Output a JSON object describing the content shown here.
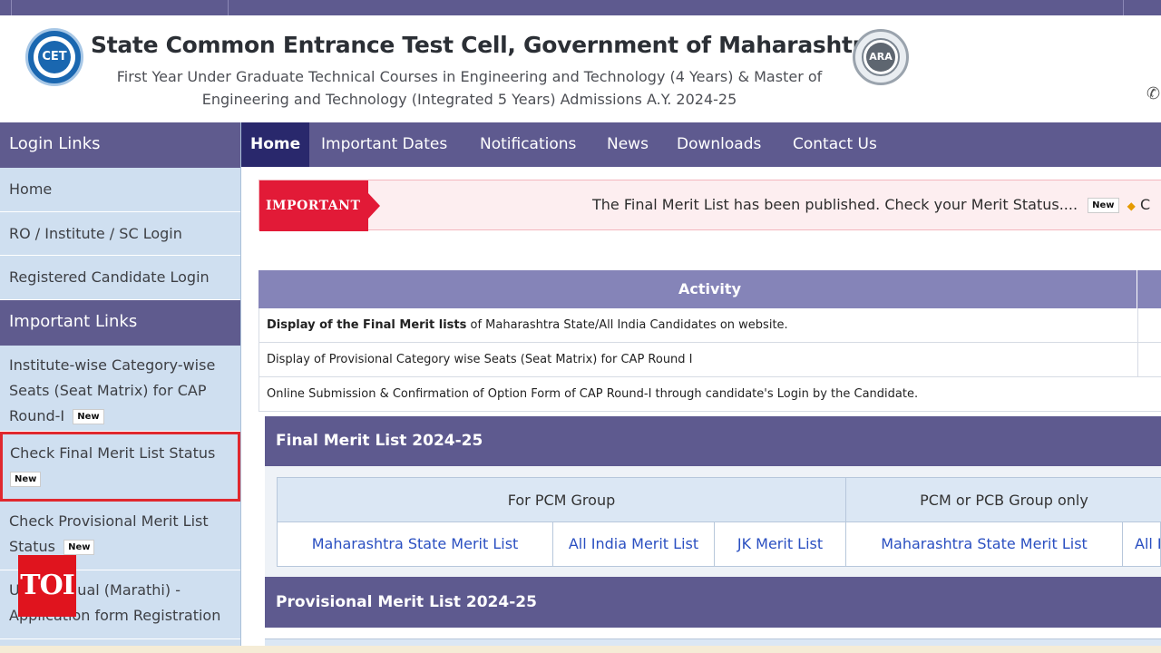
{
  "header": {
    "title": "State Common Entrance Test Cell, Government of Maharashtra",
    "subtitle_line1": "First Year Under Graduate Technical Courses in Engineering and Technology (4 Years) & Master of",
    "subtitle_line2": "Engineering and Technology (Integrated 5 Years) Admissions A.Y. 2024-25",
    "logo_left_text": "CET",
    "logo_right_text": "ARA",
    "phone_icon": "phone-icon"
  },
  "sidebar": {
    "login_heading": "Login Links",
    "login_items": [
      "Home",
      "RO / Institute / SC Login",
      "Registered Candidate Login"
    ],
    "important_heading": "Important Links",
    "important_items": [
      {
        "label": "Institute-wise Category-wise Seats (Seat Matrix) for CAP Round-I",
        "badge": "New"
      },
      {
        "label": "Check Final Merit List Status",
        "badge": "New"
      },
      {
        "label": "Check Provisional Merit List Status",
        "badge": "New"
      },
      {
        "label": "User Manual (Marathi) - Application form Registration",
        "badge": ""
      }
    ]
  },
  "nav": {
    "items": [
      "Home",
      "Important Dates",
      "Notifications",
      "News",
      "Downloads",
      "Contact Us"
    ],
    "active": "Home"
  },
  "important_bar": {
    "label": "IMPORTANT",
    "text": "The Final Merit List has been published. Check your Merit Status....",
    "badge": "New",
    "trailing": "C"
  },
  "activity_table": {
    "header": "Activity",
    "rows": [
      {
        "bold": "Display of the Final Merit lists",
        "rest": " of Maharashtra State/All India Candidates on website."
      },
      {
        "bold": "",
        "rest": "Display of Provisional Category wise Seats (Seat Matrix) for CAP Round I"
      },
      {
        "bold": "",
        "rest": "Online Submission & Confirmation of Option Form of CAP Round-I through candidate's Login by the Candidate."
      }
    ]
  },
  "final_merit": {
    "title": "Final Merit List 2024-25",
    "groups": [
      "For PCM Group",
      "PCM or PCB Group only"
    ],
    "links": [
      "Maharashtra State Merit List",
      "All India Merit List",
      "JK Merit List",
      "Maharashtra State Merit List",
      "All I"
    ]
  },
  "provisional_merit": {
    "title": "Provisional Merit List 2024-25"
  },
  "watermark": {
    "text": "TOI"
  },
  "colors": {
    "primary": "#5e5a8f",
    "nav_active": "#29286c",
    "sidebar_bg": "#cfdff0",
    "important_red": "#e21a37",
    "link_blue": "#2a4fc1",
    "highlight_border": "#e0282e"
  }
}
